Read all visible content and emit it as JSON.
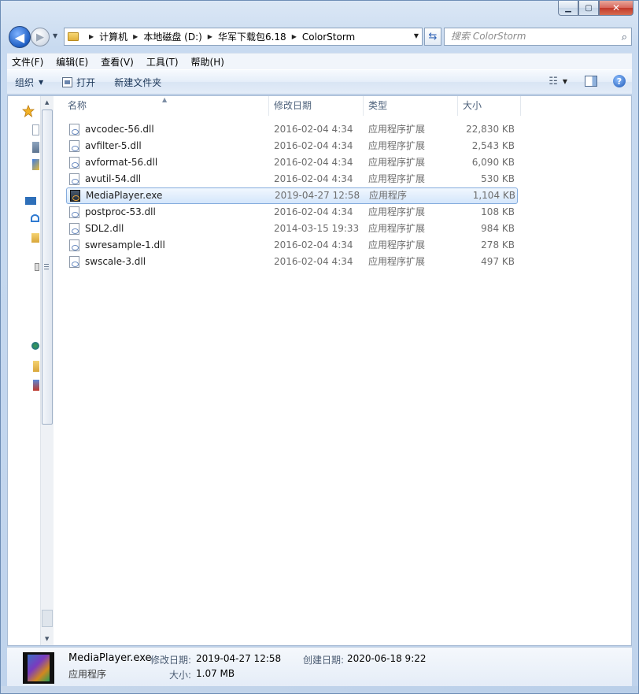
{
  "window": {
    "minimize_glyph": "▁",
    "maximize_glyph": "▢",
    "close_glyph": "✕"
  },
  "nav": {
    "back_glyph": "◀",
    "forward_glyph": "▶",
    "history_glyph": "▼",
    "breadcrumbs": [
      "计算机",
      "本地磁盘 (D:)",
      "华军下载包6.18",
      "ColorStorm"
    ],
    "separator_glyph": "▶",
    "address_dropdown_glyph": "▼",
    "refresh_glyph": "⇆",
    "search_placeholder": "搜索 ColorStorm",
    "search_icon_glyph": "⌕"
  },
  "menu": {
    "items": [
      "文件(F)",
      "编辑(E)",
      "查看(V)",
      "工具(T)",
      "帮助(H)"
    ]
  },
  "toolbar": {
    "organize_label": "组织",
    "organize_caret": "▼",
    "open_label": "打开",
    "new_folder_label": "新建文件夹",
    "views_glyph": "☷",
    "views_caret": "▼",
    "help_glyph": "?"
  },
  "columns": {
    "name": "名称",
    "date": "修改日期",
    "type": "类型",
    "size": "大小",
    "sort_glyph": "▲"
  },
  "files": [
    {
      "name": "avcodec-56.dll",
      "date": "2016-02-04 4:34",
      "type": "应用程序扩展",
      "size": "22,830 KB"
    },
    {
      "name": "avfilter-5.dll",
      "date": "2016-02-04 4:34",
      "type": "应用程序扩展",
      "size": "2,543 KB"
    },
    {
      "name": "avformat-56.dll",
      "date": "2016-02-04 4:34",
      "type": "应用程序扩展",
      "size": "6,090 KB"
    },
    {
      "name": "avutil-54.dll",
      "date": "2016-02-04 4:34",
      "type": "应用程序扩展",
      "size": "530 KB"
    },
    {
      "name": "MediaPlayer.exe",
      "date": "2019-04-27 12:58",
      "type": "应用程序",
      "size": "1,104 KB"
    },
    {
      "name": "postproc-53.dll",
      "date": "2016-02-04 4:34",
      "type": "应用程序扩展",
      "size": "108 KB"
    },
    {
      "name": "SDL2.dll",
      "date": "2014-03-15 19:33",
      "type": "应用程序扩展",
      "size": "984 KB"
    },
    {
      "name": "swresample-1.dll",
      "date": "2016-02-04 4:34",
      "type": "应用程序扩展",
      "size": "278 KB"
    },
    {
      "name": "swscale-3.dll",
      "date": "2016-02-04 4:34",
      "type": "应用程序扩展",
      "size": "497 KB"
    }
  ],
  "selected_index": 4,
  "details": {
    "name": "MediaPlayer.exe",
    "type": "应用程序",
    "modified_label": "修改日期:",
    "modified_value": "2019-04-27 12:58",
    "created_label": "创建日期:",
    "created_value": "2020-06-18 9:22",
    "size_label": "大小:",
    "size_value": "1.07 MB"
  },
  "colors": {
    "selection_border": "#84acdd",
    "accent": "#1f5fc4"
  }
}
